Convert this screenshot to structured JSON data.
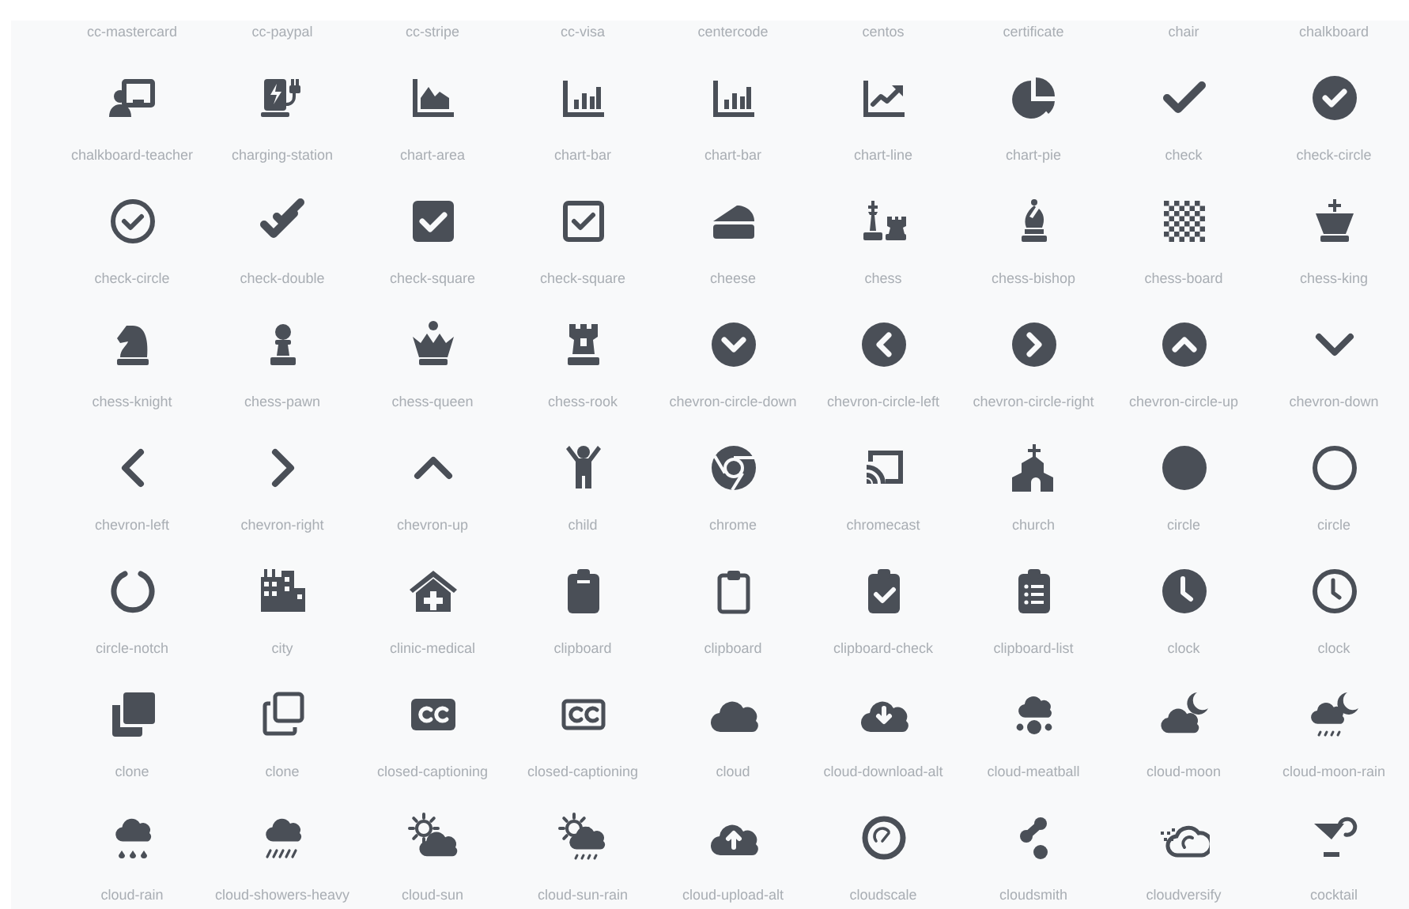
{
  "header_labels": [
    "cc-mastercard",
    "cc-paypal",
    "cc-stripe",
    "cc-visa",
    "centercode",
    "centos",
    "certificate",
    "chair",
    "chalkboard"
  ],
  "icon_labels": [
    "chalkboard-teacher",
    "charging-station",
    "chart-area",
    "chart-bar",
    "chart-bar",
    "chart-line",
    "chart-pie",
    "check",
    "check-circle",
    "check-circle",
    "check-double",
    "check-square",
    "check-square",
    "cheese",
    "chess",
    "chess-bishop",
    "chess-board",
    "chess-king",
    "chess-knight",
    "chess-pawn",
    "chess-queen",
    "chess-rook",
    "chevron-circle-down",
    "chevron-circle-left",
    "chevron-circle-right",
    "chevron-circle-up",
    "chevron-down",
    "chevron-left",
    "chevron-right",
    "chevron-up",
    "child",
    "chrome",
    "chromecast",
    "church",
    "circle",
    "circle",
    "circle-notch",
    "city",
    "clinic-medical",
    "clipboard",
    "clipboard",
    "clipboard-check",
    "clipboard-list",
    "clock",
    "clock",
    "clone",
    "clone",
    "closed-captioning",
    "closed-captioning",
    "cloud",
    "cloud-download-alt",
    "cloud-meatball",
    "cloud-moon",
    "cloud-moon-rain",
    "cloud-rain",
    "cloud-showers-heavy",
    "cloud-sun",
    "cloud-sun-rain",
    "cloud-upload-alt",
    "cloudscale",
    "cloudsmith",
    "cloudversify",
    "cocktail"
  ]
}
